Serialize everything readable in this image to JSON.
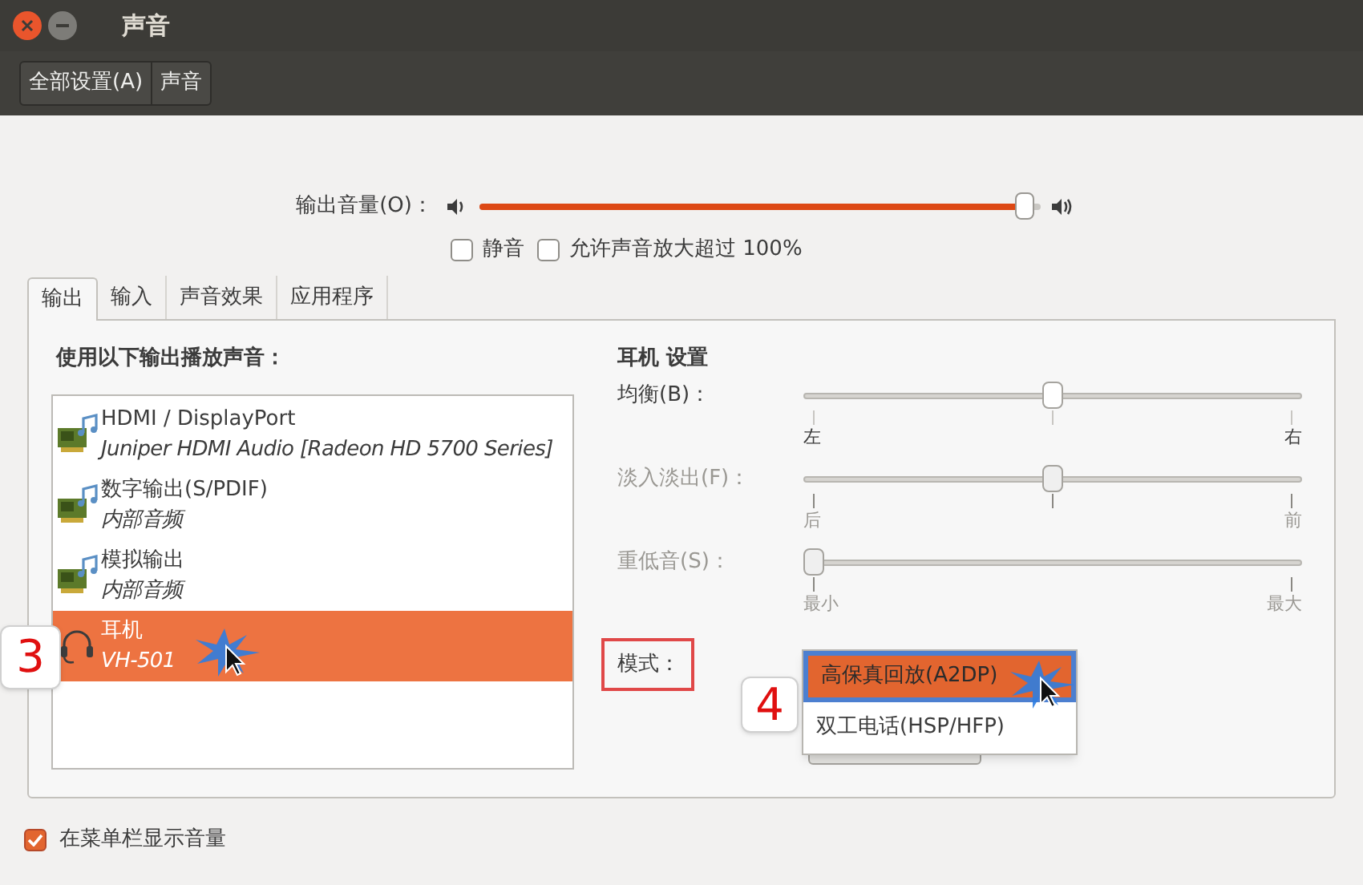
{
  "window": {
    "title": "声音"
  },
  "toolbar": {
    "breadcrumbs": [
      {
        "label": "全部设置(A)"
      },
      {
        "label": "声音"
      }
    ]
  },
  "output_volume": {
    "label": "输出音量(O)：",
    "level": 0.97
  },
  "options": [
    {
      "label": "静音",
      "checked": false
    },
    {
      "label": "允许声音放大超过 100%",
      "checked": false
    }
  ],
  "tabs": [
    {
      "label": "输出",
      "selected": true
    },
    {
      "label": "输入",
      "selected": false
    },
    {
      "label": "声音效果",
      "selected": false
    },
    {
      "label": "应用程序",
      "selected": false
    }
  ],
  "devices": {
    "heading": "使用以下输出播放声音：",
    "items": [
      {
        "kind": "card",
        "name": "HDMI / DisplayPort",
        "description": "Juniper HDMI Audio [Radeon HD 5700 Series]",
        "selected": false
      },
      {
        "kind": "card",
        "name": "数字输出(S/PDIF)",
        "description": "内部音频",
        "selected": false
      },
      {
        "kind": "card",
        "name": "模拟输出",
        "description": "内部音频",
        "selected": false
      },
      {
        "kind": "headphones",
        "name": "耳机",
        "description": "VH-501",
        "selected": true
      }
    ]
  },
  "settings": {
    "heading": "耳机 设置",
    "sliders": [
      {
        "label": "均衡(B)：",
        "level": 0.5,
        "disabled": false,
        "center_mark": true,
        "min_label": "左",
        "max_label": "右"
      },
      {
        "label": "淡入淡出(F)：",
        "level": 0.5,
        "disabled": true,
        "center_mark": true,
        "min_label": "后",
        "max_label": "前"
      },
      {
        "label": "重低音(S)：",
        "level": 0,
        "disabled": true,
        "center_mark": false,
        "min_label": "最小",
        "max_label": "最大"
      }
    ],
    "mode": {
      "label": "模式："
    },
    "mode_menu": [
      {
        "label": "高保真回放(A2DP)",
        "selected": true
      },
      {
        "label": "双工电话(HSP/HFP)",
        "selected": false
      }
    ]
  },
  "show_in_menu_bar": {
    "label": "在菜单栏显示音量",
    "checked": true
  },
  "annotations": [
    {
      "label": "3"
    },
    {
      "label": "4"
    }
  ]
}
